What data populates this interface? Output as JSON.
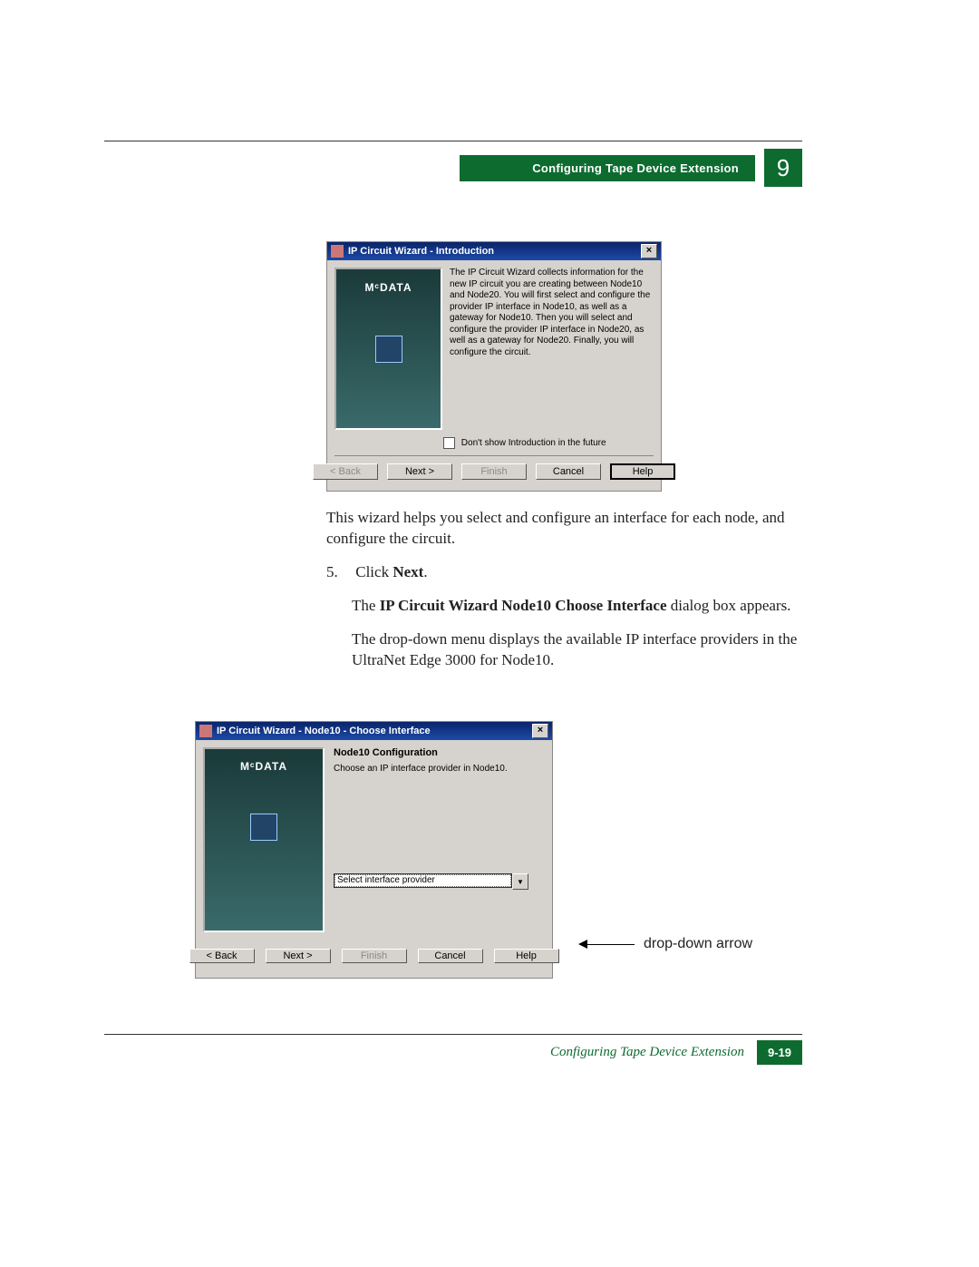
{
  "header": {
    "section_title": "Configuring Tape Device Extension",
    "chapter_number": "9"
  },
  "dialog1": {
    "title": "IP Circuit Wizard - Introduction",
    "brand": "MᶜDATA",
    "intro_text": "The IP Circuit Wizard collects information for the new IP circuit you are creating between Node10 and Node20. You will first select and configure the provider IP interface in Node10, as well as a gateway for Node10. Then you will select and configure the provider IP interface in Node20, as well as a gateway for Node20. Finally, you will configure the circuit.",
    "checkbox_label": "Don't show Introduction in the future",
    "buttons": {
      "back": "< Back",
      "next": "Next >",
      "finish": "Finish",
      "cancel": "Cancel",
      "help": "Help"
    }
  },
  "body": {
    "p1": "This wizard helps you select and configure an interface for each node, and configure the circuit.",
    "step5_num": "5.",
    "step5_text_a": "Click ",
    "step5_text_b": "Next",
    "step5_text_c": ".",
    "p2_a": "The ",
    "p2_b": "IP Circuit Wizard Node10 Choose Interface",
    "p2_c": " dialog box appears.",
    "p3": "The drop-down menu displays the available IP interface providers in the UltraNet Edge 3000 for Node10."
  },
  "dialog2": {
    "title": "IP Circuit Wizard - Node10 - Choose Interface",
    "brand": "MᶜDATA",
    "cfg_head": "Node10 Configuration",
    "cfg_sub": "Choose an IP interface provider in Node10.",
    "select_value": "Select interface provider",
    "buttons": {
      "back": "< Back",
      "next": "Next >",
      "finish": "Finish",
      "cancel": "Cancel",
      "help": "Help"
    }
  },
  "callout": "drop-down arrow",
  "footer": {
    "title": "Configuring Tape Device Extension",
    "page": "9-19"
  }
}
